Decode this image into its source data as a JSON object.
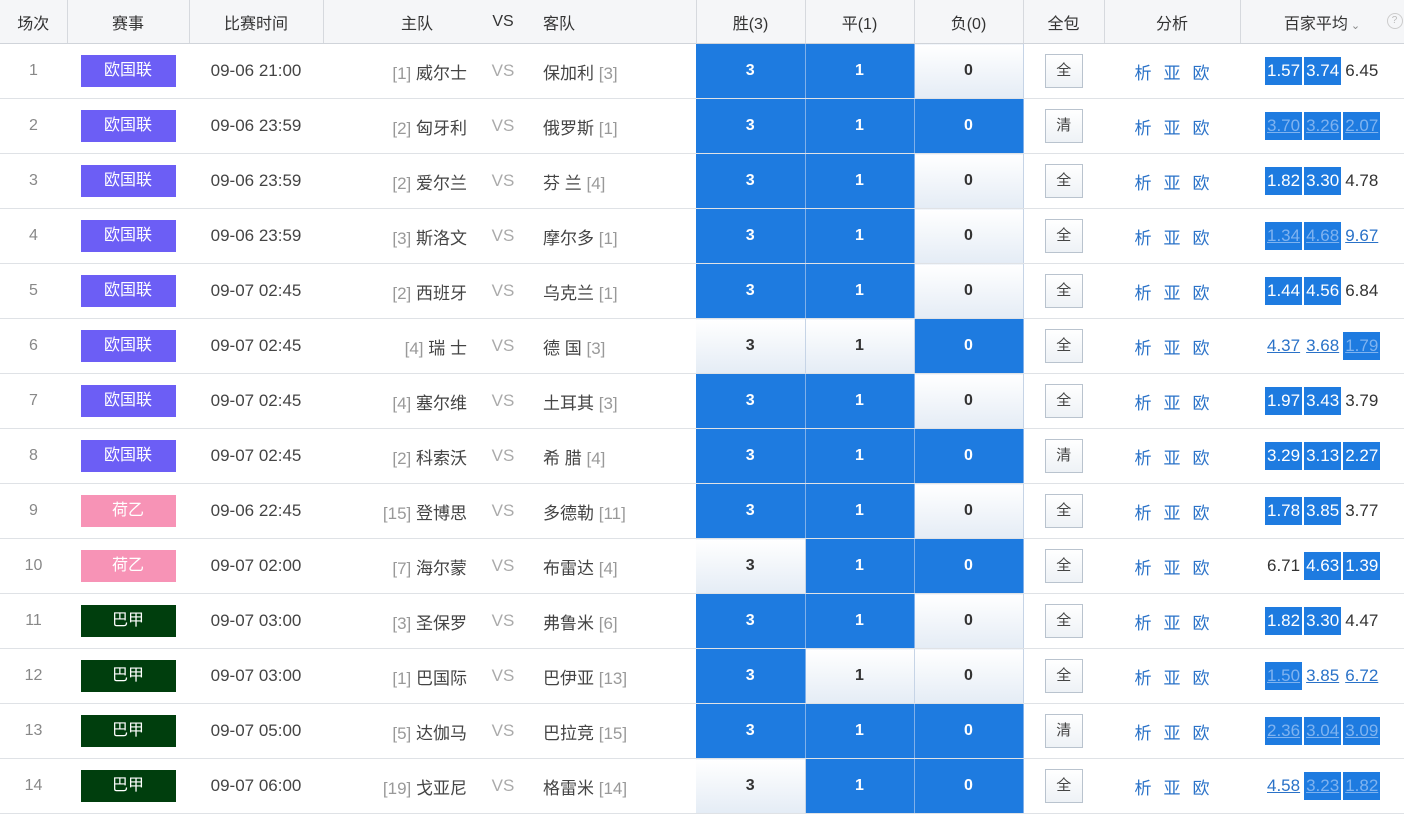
{
  "header": {
    "idx": "场次",
    "league": "赛事",
    "time": "比赛时间",
    "home": "主队",
    "vs": "VS",
    "away": "客队",
    "win": "胜(3)",
    "draw": "平(1)",
    "loss": "负(0)",
    "all": "全包",
    "analysis": "分析",
    "avg": "百家平均",
    "help_icon": "question-icon",
    "help_label": "?"
  },
  "league_colors": {
    "欧国联": "#6c5ef5",
    "荷乙": "#f793b6",
    "巴甲": "#003e0d",
    "highlight": "#1e7be0"
  },
  "analysis_labels": [
    "析",
    "亚",
    "欧"
  ],
  "matches": [
    {
      "idx": "1",
      "league": "欧国联",
      "time": "09-06 21:00",
      "home_rank": "[1]",
      "home": "威尔士",
      "vs": "VS",
      "away": "保加利",
      "away_rank": "[3]",
      "win": "3",
      "draw": "1",
      "loss": "0",
      "win_on": true,
      "draw_on": true,
      "loss_on": false,
      "all": "全",
      "odds": [
        {
          "v": "1.57",
          "hl": true,
          "u": false
        },
        {
          "v": "3.74",
          "hl": true,
          "u": false
        },
        {
          "v": "6.45",
          "hl": false,
          "u": false
        }
      ]
    },
    {
      "idx": "2",
      "league": "欧国联",
      "time": "09-06 23:59",
      "home_rank": "[2]",
      "home": "匈牙利",
      "vs": "VS",
      "away": "俄罗斯",
      "away_rank": "[1]",
      "win": "3",
      "draw": "1",
      "loss": "0",
      "win_on": true,
      "draw_on": true,
      "loss_on": true,
      "all": "清",
      "odds": [
        {
          "v": "3.70",
          "hl": true,
          "u": true
        },
        {
          "v": "3.26",
          "hl": true,
          "u": true
        },
        {
          "v": "2.07",
          "hl": true,
          "u": true
        }
      ]
    },
    {
      "idx": "3",
      "league": "欧国联",
      "time": "09-06 23:59",
      "home_rank": "[2]",
      "home": "爱尔兰",
      "vs": "VS",
      "away": "芬 兰",
      "away_rank": "[4]",
      "win": "3",
      "draw": "1",
      "loss": "0",
      "win_on": true,
      "draw_on": true,
      "loss_on": false,
      "all": "全",
      "odds": [
        {
          "v": "1.82",
          "hl": true,
          "u": false
        },
        {
          "v": "3.30",
          "hl": true,
          "u": false
        },
        {
          "v": "4.78",
          "hl": false,
          "u": false
        }
      ]
    },
    {
      "idx": "4",
      "league": "欧国联",
      "time": "09-06 23:59",
      "home_rank": "[3]",
      "home": "斯洛文",
      "vs": "VS",
      "away": "摩尔多",
      "away_rank": "[1]",
      "win": "3",
      "draw": "1",
      "loss": "0",
      "win_on": true,
      "draw_on": true,
      "loss_on": false,
      "all": "全",
      "odds": [
        {
          "v": "1.34",
          "hl": true,
          "u": true
        },
        {
          "v": "4.68",
          "hl": true,
          "u": true
        },
        {
          "v": "9.67",
          "hl": false,
          "u": true
        }
      ]
    },
    {
      "idx": "5",
      "league": "欧国联",
      "time": "09-07 02:45",
      "home_rank": "[2]",
      "home": "西班牙",
      "vs": "VS",
      "away": "乌克兰",
      "away_rank": "[1]",
      "win": "3",
      "draw": "1",
      "loss": "0",
      "win_on": true,
      "draw_on": true,
      "loss_on": false,
      "all": "全",
      "odds": [
        {
          "v": "1.44",
          "hl": true,
          "u": false
        },
        {
          "v": "4.56",
          "hl": true,
          "u": false
        },
        {
          "v": "6.84",
          "hl": false,
          "u": false
        }
      ]
    },
    {
      "idx": "6",
      "league": "欧国联",
      "time": "09-07 02:45",
      "home_rank": "[4]",
      "home": "瑞 士",
      "vs": "VS",
      "away": "德 国",
      "away_rank": "[3]",
      "win": "3",
      "draw": "1",
      "loss": "0",
      "win_on": false,
      "draw_on": false,
      "loss_on": true,
      "all": "全",
      "odds": [
        {
          "v": "4.37",
          "hl": false,
          "u": true
        },
        {
          "v": "3.68",
          "hl": false,
          "u": true
        },
        {
          "v": "1.79",
          "hl": true,
          "u": true
        }
      ]
    },
    {
      "idx": "7",
      "league": "欧国联",
      "time": "09-07 02:45",
      "home_rank": "[4]",
      "home": "塞尔维",
      "vs": "VS",
      "away": "土耳其",
      "away_rank": "[3]",
      "win": "3",
      "draw": "1",
      "loss": "0",
      "win_on": true,
      "draw_on": true,
      "loss_on": false,
      "all": "全",
      "odds": [
        {
          "v": "1.97",
          "hl": true,
          "u": false
        },
        {
          "v": "3.43",
          "hl": true,
          "u": false
        },
        {
          "v": "3.79",
          "hl": false,
          "u": false
        }
      ]
    },
    {
      "idx": "8",
      "league": "欧国联",
      "time": "09-07 02:45",
      "home_rank": "[2]",
      "home": "科索沃",
      "vs": "VS",
      "away": "希 腊",
      "away_rank": "[4]",
      "win": "3",
      "draw": "1",
      "loss": "0",
      "win_on": true,
      "draw_on": true,
      "loss_on": true,
      "all": "清",
      "odds": [
        {
          "v": "3.29",
          "hl": true,
          "u": false
        },
        {
          "v": "3.13",
          "hl": true,
          "u": false
        },
        {
          "v": "2.27",
          "hl": true,
          "u": false
        }
      ]
    },
    {
      "idx": "9",
      "league": "荷乙",
      "time": "09-06 22:45",
      "home_rank": "[15]",
      "home": "登博思",
      "vs": "VS",
      "away": "多德勒",
      "away_rank": "[11]",
      "win": "3",
      "draw": "1",
      "loss": "0",
      "win_on": true,
      "draw_on": true,
      "loss_on": false,
      "all": "全",
      "odds": [
        {
          "v": "1.78",
          "hl": true,
          "u": false
        },
        {
          "v": "3.85",
          "hl": true,
          "u": false
        },
        {
          "v": "3.77",
          "hl": false,
          "u": false
        }
      ]
    },
    {
      "idx": "10",
      "league": "荷乙",
      "time": "09-07 02:00",
      "home_rank": "[7]",
      "home": "海尔蒙",
      "vs": "VS",
      "away": "布雷达",
      "away_rank": "[4]",
      "win": "3",
      "draw": "1",
      "loss": "0",
      "win_on": false,
      "draw_on": true,
      "loss_on": true,
      "all": "全",
      "odds": [
        {
          "v": "6.71",
          "hl": false,
          "u": false
        },
        {
          "v": "4.63",
          "hl": true,
          "u": false
        },
        {
          "v": "1.39",
          "hl": true,
          "u": false
        }
      ]
    },
    {
      "idx": "11",
      "league": "巴甲",
      "time": "09-07 03:00",
      "home_rank": "[3]",
      "home": "圣保罗",
      "vs": "VS",
      "away": "弗鲁米",
      "away_rank": "[6]",
      "win": "3",
      "draw": "1",
      "loss": "0",
      "win_on": true,
      "draw_on": true,
      "loss_on": false,
      "all": "全",
      "odds": [
        {
          "v": "1.82",
          "hl": true,
          "u": false
        },
        {
          "v": "3.30",
          "hl": true,
          "u": false
        },
        {
          "v": "4.47",
          "hl": false,
          "u": false
        }
      ]
    },
    {
      "idx": "12",
      "league": "巴甲",
      "time": "09-07 03:00",
      "home_rank": "[1]",
      "home": "巴国际",
      "vs": "VS",
      "away": "巴伊亚",
      "away_rank": "[13]",
      "win": "3",
      "draw": "1",
      "loss": "0",
      "win_on": true,
      "draw_on": false,
      "loss_on": false,
      "all": "全",
      "odds": [
        {
          "v": "1.50",
          "hl": true,
          "u": true
        },
        {
          "v": "3.85",
          "hl": false,
          "u": true
        },
        {
          "v": "6.72",
          "hl": false,
          "u": true
        }
      ]
    },
    {
      "idx": "13",
      "league": "巴甲",
      "time": "09-07 05:00",
      "home_rank": "[5]",
      "home": "达伽马",
      "vs": "VS",
      "away": "巴拉竞",
      "away_rank": "[15]",
      "win": "3",
      "draw": "1",
      "loss": "0",
      "win_on": true,
      "draw_on": true,
      "loss_on": true,
      "all": "清",
      "odds": [
        {
          "v": "2.36",
          "hl": true,
          "u": true
        },
        {
          "v": "3.04",
          "hl": true,
          "u": true
        },
        {
          "v": "3.09",
          "hl": true,
          "u": true
        }
      ]
    },
    {
      "idx": "14",
      "league": "巴甲",
      "time": "09-07 06:00",
      "home_rank": "[19]",
      "home": "戈亚尼",
      "vs": "VS",
      "away": "格雷米",
      "away_rank": "[14]",
      "win": "3",
      "draw": "1",
      "loss": "0",
      "win_on": false,
      "draw_on": true,
      "loss_on": true,
      "all": "全",
      "odds": [
        {
          "v": "4.58",
          "hl": false,
          "u": true
        },
        {
          "v": "3.23",
          "hl": true,
          "u": true
        },
        {
          "v": "1.82",
          "hl": true,
          "u": true
        }
      ]
    }
  ]
}
